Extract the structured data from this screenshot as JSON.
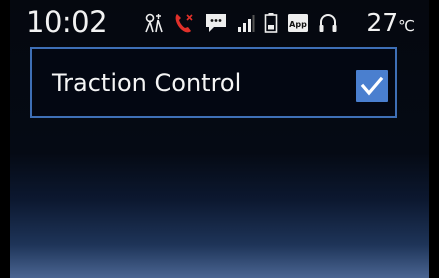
{
  "status_bar": {
    "time": "10:02",
    "temperature": "27",
    "temperature_unit": "℃",
    "icons": [
      "traffic-info-icon",
      "missed-call-icon",
      "message-icon",
      "signal-icon",
      "battery-icon",
      "app-icon",
      "headphones-icon"
    ],
    "app_icon_label": "App",
    "missed_call_color": "#e0302a"
  },
  "settings": {
    "items": [
      {
        "label": "Traction Control",
        "checked": true
      }
    ]
  },
  "colors": {
    "accent": "#3e6fb6",
    "checkbox": "#4a7fcf"
  }
}
